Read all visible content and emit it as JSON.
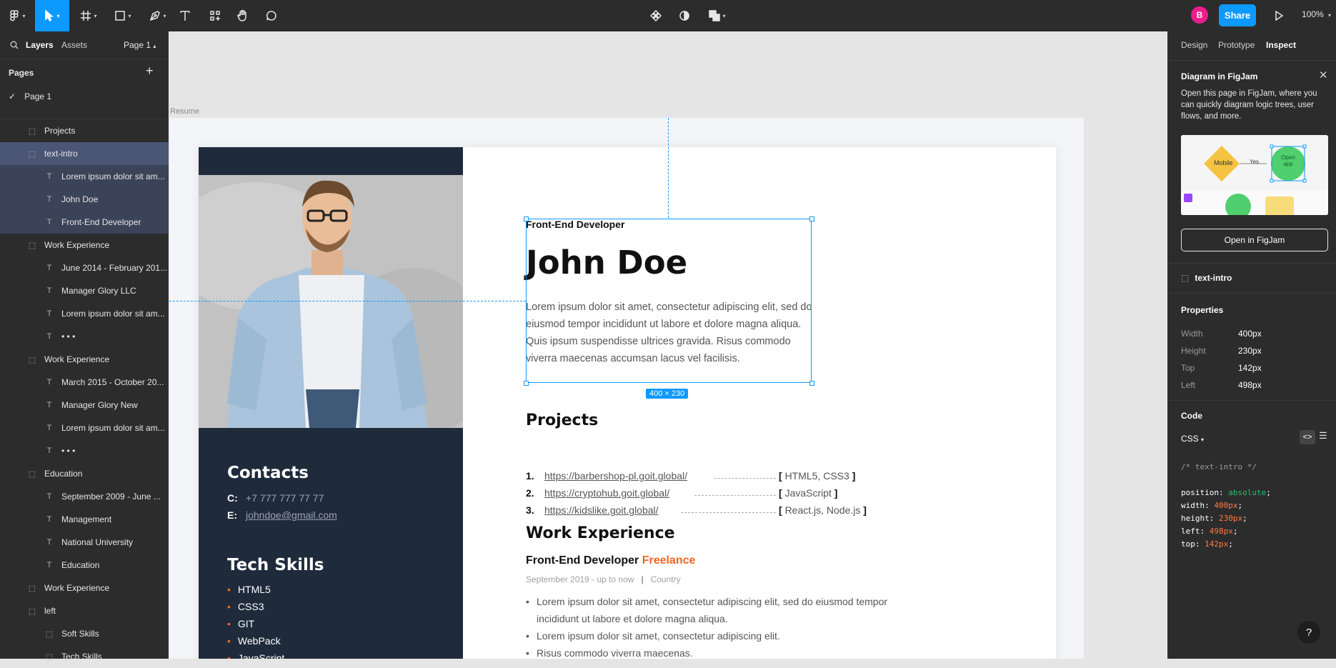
{
  "topbar": {
    "share_label": "Share",
    "avatar_initial": "B",
    "zoom": "100%"
  },
  "left_panel": {
    "tabs": {
      "layers": "Layers",
      "assets": "Assets",
      "page": "Page 1"
    },
    "pages_heading": "Pages",
    "current_page": "Page 1",
    "layers": [
      {
        "label": "Projects",
        "type": "frame",
        "indent": 1,
        "state": ""
      },
      {
        "label": "text-intro",
        "type": "frame",
        "indent": 1,
        "state": "sel"
      },
      {
        "label": "Lorem ipsum dolor sit am...",
        "type": "text",
        "indent": 2,
        "state": "sub"
      },
      {
        "label": "John Doe",
        "type": "text",
        "indent": 2,
        "state": "sub"
      },
      {
        "label": "Front-End Developer",
        "type": "text",
        "indent": 2,
        "state": "sub"
      },
      {
        "label": "Work Experience",
        "type": "frame",
        "indent": 1,
        "state": ""
      },
      {
        "label": "June 2014 - February 201...",
        "type": "text",
        "indent": 2,
        "state": ""
      },
      {
        "label": "Manager Glory LLC",
        "type": "text",
        "indent": 2,
        "state": ""
      },
      {
        "label": "Lorem ipsum dolor sit am...",
        "type": "text",
        "indent": 2,
        "state": ""
      },
      {
        "label": "• • •",
        "type": "text",
        "indent": 2,
        "state": ""
      },
      {
        "label": "Work Experience",
        "type": "frame",
        "indent": 1,
        "state": ""
      },
      {
        "label": "March 2015 - October 20...",
        "type": "text",
        "indent": 2,
        "state": ""
      },
      {
        "label": "Manager Glory New",
        "type": "text",
        "indent": 2,
        "state": ""
      },
      {
        "label": "Lorem ipsum dolor sit am...",
        "type": "text",
        "indent": 2,
        "state": ""
      },
      {
        "label": "• • •",
        "type": "text",
        "indent": 2,
        "state": ""
      },
      {
        "label": "Education",
        "type": "frame",
        "indent": 1,
        "state": ""
      },
      {
        "label": "September 2009 - June ...",
        "type": "text",
        "indent": 2,
        "state": ""
      },
      {
        "label": "Management",
        "type": "text",
        "indent": 2,
        "state": ""
      },
      {
        "label": "National University",
        "type": "text",
        "indent": 2,
        "state": ""
      },
      {
        "label": "Education",
        "type": "text",
        "indent": 2,
        "state": ""
      },
      {
        "label": "Work Experience",
        "type": "frame",
        "indent": 1,
        "state": ""
      },
      {
        "label": "left",
        "type": "frame",
        "indent": 1,
        "state": ""
      },
      {
        "label": "Soft Skills",
        "type": "frame",
        "indent": 2,
        "state": ""
      },
      {
        "label": "Tech Skills",
        "type": "frame",
        "indent": 2,
        "state": ""
      }
    ]
  },
  "canvas": {
    "frame_label": "Resume",
    "dimension_badge": "400 × 230",
    "resume": {
      "role": "Front-End Developer",
      "name": "John Doe",
      "intro": "Lorem ipsum dolor sit amet, consectetur adipiscing elit, sed do eiusmod tempor incididunt ut labore et dolore magna aliqua. Quis ipsum suspendisse ultrices gravida. Risus commodo viverra maecenas accumsan lacus vel facilisis.",
      "contacts_heading": "Contacts",
      "phone_key": "C:",
      "phone": "+7 777 777 77 77",
      "email_key": "E:",
      "email": "johndoe@gmail.com",
      "tech_heading": "Tech Skills",
      "tech_skills": [
        "HTML5",
        "CSS3",
        "GIT",
        "WebPack",
        "JavaScript"
      ],
      "projects_heading": "Projects",
      "projects": [
        {
          "num": "1.",
          "url": "https://barbershop-pl.goit.global/",
          "tech": "HTML5, CSS3"
        },
        {
          "num": "2.",
          "url": "https://cryptohub.goit.global/",
          "tech": "JavaScript"
        },
        {
          "num": "3.",
          "url": "https://kidslike.goit.global/",
          "tech": "React.js, Node.js"
        }
      ],
      "work_heading": "Work Experience",
      "job_title": "Front-End Developer",
      "job_company": "Freelance",
      "job_dates": "September 2019 - up to now",
      "job_sep": "|",
      "job_location": "Country",
      "job_bullets": [
        "Lorem ipsum dolor sit amet, consectetur adipiscing elit, sed do eiusmod tempor incididunt ut labore et dolore magna aliqua.",
        "Lorem ipsum dolor sit amet, consectetur adipiscing elit.",
        "Risus commodo viverra maecenas."
      ]
    }
  },
  "right_panel": {
    "tabs": {
      "design": "Design",
      "prototype": "Prototype",
      "inspect": "Inspect"
    },
    "figjam": {
      "title": "Diagram in FigJam",
      "text": "Open this page in FigJam, where you can quickly diagram logic trees, user flows, and more.",
      "preview_mobile": "Mobile",
      "preview_yes": "Yes",
      "preview_open": "Open app",
      "button": "Open in FigJam"
    },
    "selection_name": "text-intro",
    "properties_heading": "Properties",
    "properties": [
      {
        "k": "Width",
        "v": "400px"
      },
      {
        "k": "Height",
        "v": "230px"
      },
      {
        "k": "Top",
        "v": "142px"
      },
      {
        "k": "Left",
        "v": "498px"
      }
    ],
    "code_heading": "Code",
    "code_lang": "CSS",
    "code_comment": "/* text-intro */",
    "code_lines": [
      {
        "prop": "position:",
        "val": "absolute",
        "color": "green"
      },
      {
        "prop": "width:",
        "val": "400px",
        "color": "orange"
      },
      {
        "prop": "height:",
        "val": "230px",
        "color": "orange"
      },
      {
        "prop": "left:",
        "val": "498px",
        "color": "orange"
      },
      {
        "prop": "top:",
        "val": "142px",
        "color": "orange"
      }
    ]
  },
  "colors": {
    "accent": "#0d99ff",
    "sidebar": "#1f2a3b",
    "orange": "#f26522"
  }
}
